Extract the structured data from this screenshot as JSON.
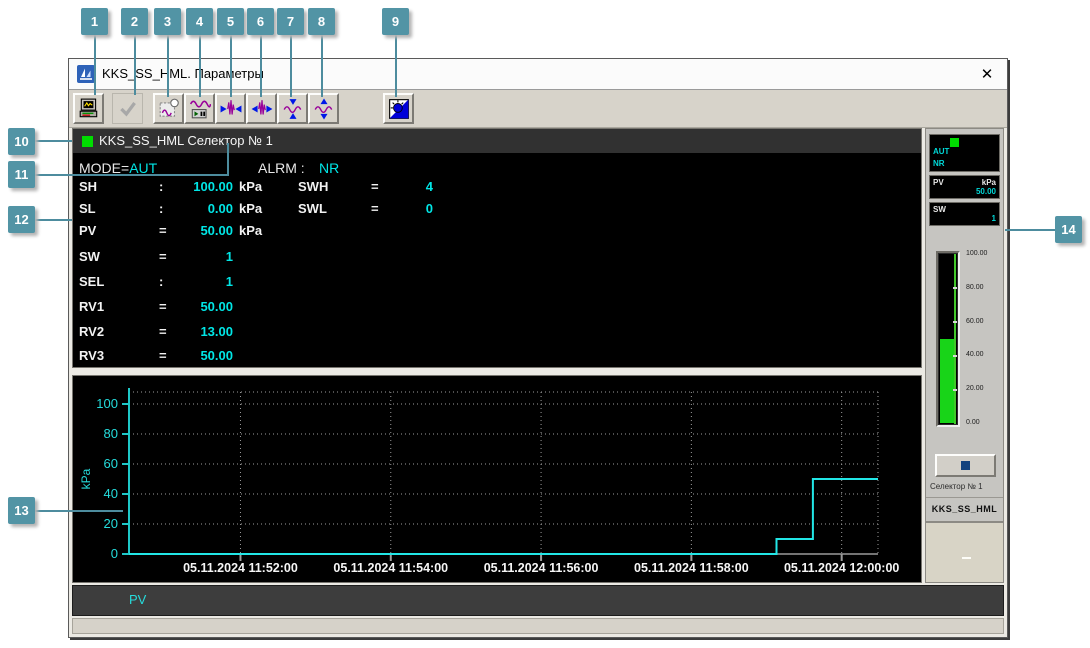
{
  "callouts": [
    "1",
    "2",
    "3",
    "4",
    "5",
    "6",
    "7",
    "8",
    "9",
    "10",
    "11",
    "12",
    "13",
    "14"
  ],
  "window": {
    "title": "KKS_SS_HML. Параметры",
    "close_glyph": "✕"
  },
  "toolbar": {
    "icons": [
      "print-trend-icon",
      "apply-check-icon",
      "snapshot-image-icon",
      "trend-run-pause-icon",
      "compress-time-axis-icon",
      "expand-time-axis-icon",
      "compress-value-axis-icon",
      "expand-value-axis-icon",
      "invert-colors-icon"
    ]
  },
  "param": {
    "header_title": "KKS_SS_HML Селектор № 1",
    "mode_label": "MODE=",
    "mode_value": "AUT",
    "alrm_label": "ALRM : ",
    "alrm_value": "NR",
    "rows": [
      {
        "label": "SH",
        "sep": ":",
        "value": "100.00",
        "unit": "kPa",
        "label2": "SWH",
        "sep2": "=",
        "value2": "4"
      },
      {
        "label": "SL",
        "sep": ":",
        "value": "0.00",
        "unit": "kPa",
        "label2": "SWL",
        "sep2": "=",
        "value2": "0"
      },
      {
        "label": "PV",
        "sep": "=",
        "value": "50.00",
        "unit": "kPa"
      },
      {
        "label": "SW",
        "sep": "=",
        "value": "1"
      },
      {
        "label": "SEL",
        "sep": ":",
        "value": "1"
      },
      {
        "label": "RV1",
        "sep": "=",
        "value": "50.00"
      },
      {
        "label": "RV2",
        "sep": "=",
        "value": "13.00"
      },
      {
        "label": "RV3",
        "sep": "=",
        "value": "50.00"
      }
    ]
  },
  "chart_data": {
    "type": "line",
    "ylabel": "kPa",
    "ylim": [
      0,
      100
    ],
    "y_ticks": [
      0,
      20,
      40,
      60,
      80,
      100
    ],
    "x_ticks": [
      "05.11.2024 11:52:00",
      "05.11.2024 11:54:00",
      "05.11.2024 11:56:00",
      "05.11.2024 11:58:00",
      "05.11.2024 12:00:00"
    ],
    "x_domain": [
      "05.11.2024 11:50:31",
      "05.11.2024 12:00:29"
    ],
    "grid": "dotted",
    "series": [
      {
        "name": "PV",
        "color": "#22e6e6",
        "points": [
          [
            "05.11.2024 11:50:31",
            0
          ],
          [
            "05.11.2024 11:59:08",
            0
          ],
          [
            "05.11.2024 11:59:08",
            10
          ],
          [
            "05.11.2024 11:59:37",
            10
          ],
          [
            "05.11.2024 11:59:37",
            50
          ],
          [
            "05.11.2024 12:00:29",
            50
          ]
        ]
      }
    ]
  },
  "legend": {
    "series_label": "PV"
  },
  "faceplate": {
    "status": {
      "mode": "AUT",
      "alarm": "NR"
    },
    "pv": {
      "label": "PV",
      "unit": "kPa",
      "value": "50.00"
    },
    "sw": {
      "label": "SW",
      "value": "1"
    },
    "gauge": {
      "value": 50,
      "max": 100,
      "labels": [
        "100.00",
        "80.00",
        "60.00",
        "40.00",
        "20.00",
        "0.00"
      ]
    },
    "tag_label": "Селектор № 1",
    "tag_name": "KKS_SS_HML"
  },
  "colors": {
    "accent_cyan": "#00e6e6",
    "indicator_green": "#00dc00",
    "gauge_green": "#18d418",
    "badge_teal": "#5294a5",
    "panel_black": "#000000"
  }
}
